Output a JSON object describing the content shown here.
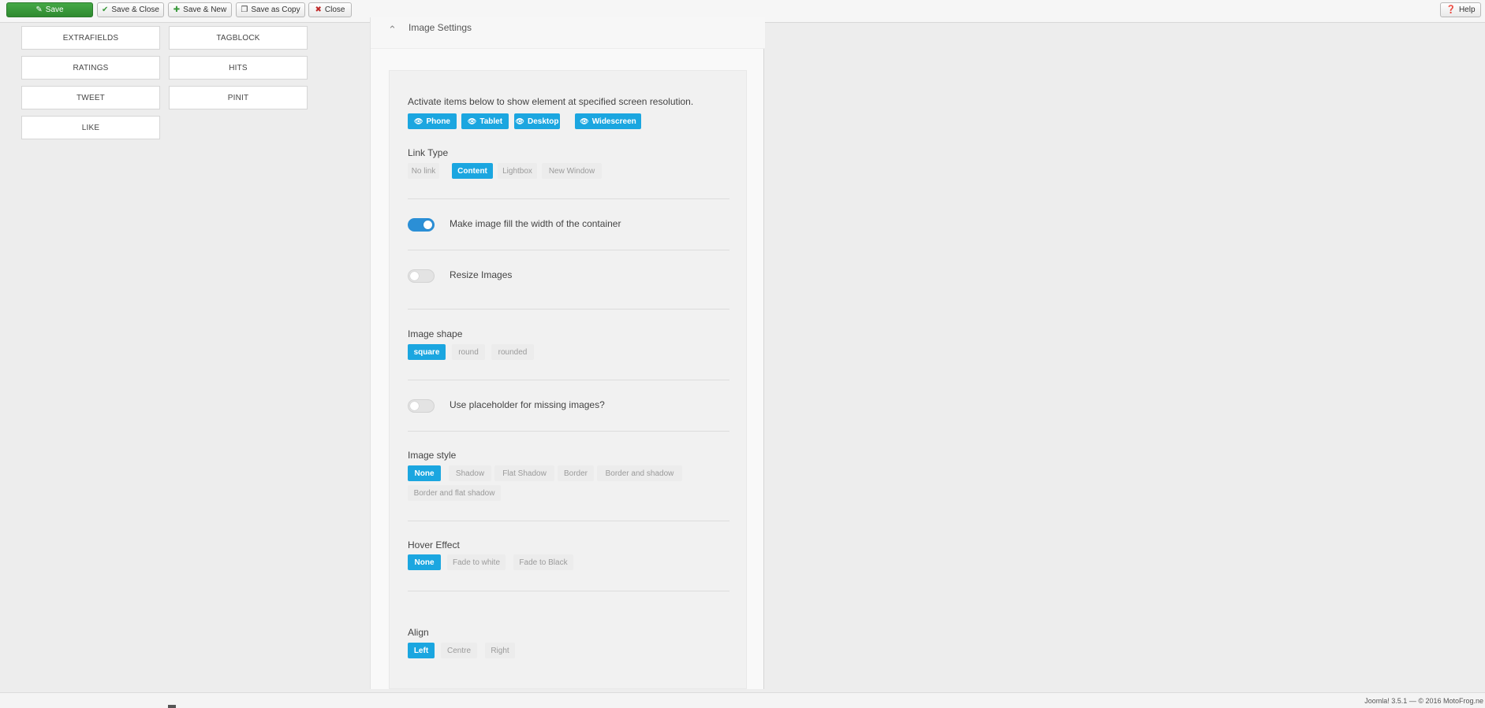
{
  "toolbar": {
    "save": "Save",
    "save_close": "Save & Close",
    "save_new": "Save & New",
    "save_copy": "Save as Copy",
    "close": "Close",
    "help": "Help"
  },
  "positions": [
    "EXTRAFIELDS",
    "TAGBLOCK",
    "RATINGS",
    "HITS",
    "TWEET",
    "PINIT",
    "LIKE"
  ],
  "section": {
    "title": "Image Settings"
  },
  "settings": {
    "resolution_intro": "Activate items below to show element at specified screen resolution.",
    "devices": [
      "Phone",
      "Tablet",
      "Desktop",
      "Widescreen"
    ],
    "link_type": {
      "label": "Link Type",
      "options": [
        "No link",
        "Content",
        "Lightbox",
        "New Window"
      ],
      "selected": "Content"
    },
    "fill_width": {
      "label": "Make image fill the width of the container",
      "enabled": true
    },
    "resize": {
      "label": "Resize Images",
      "enabled": false
    },
    "image_shape": {
      "label": "Image shape",
      "options": [
        "square",
        "round",
        "rounded"
      ],
      "selected": "square"
    },
    "placeholder": {
      "label": "Use placeholder for missing images?",
      "enabled": false
    },
    "image_style": {
      "label": "Image style",
      "options": [
        "None",
        "Shadow",
        "Flat Shadow",
        "Border",
        "Border and shadow",
        "Border and flat shadow"
      ],
      "selected": "None"
    },
    "hover_effect": {
      "label": "Hover Effect",
      "options": [
        "None",
        "Fade to white",
        "Fade to Black"
      ],
      "selected": "None"
    },
    "align": {
      "label": "Align",
      "options": [
        "Left",
        "Centre",
        "Right"
      ],
      "selected": "Left"
    }
  },
  "footer": {
    "text": "Joomla! 3.5.1 — © 2016 MotoFrog.ne"
  },
  "colors": {
    "accent": "#1ba6e0",
    "save_green": "#3a9a3b",
    "toggle_on": "#2b8fd6"
  }
}
